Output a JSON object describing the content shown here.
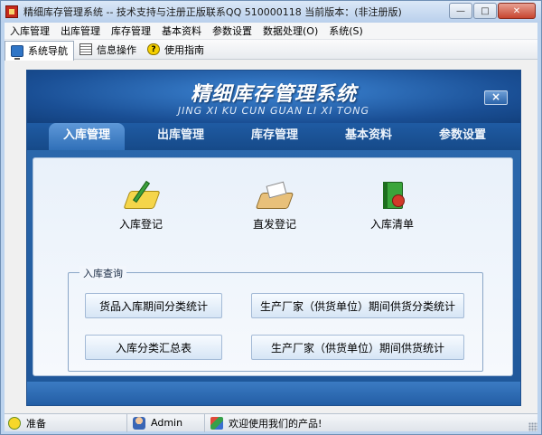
{
  "window": {
    "title": "精细库存管理系统 -- 技术支持与注册正版联系QQ 510000118    当前版本：(非注册版)",
    "minimize_glyph": "—",
    "maximize_glyph": "□",
    "close_glyph": "✕"
  },
  "menubar": {
    "items": [
      "入库管理",
      "出库管理",
      "库存管理",
      "基本资料",
      "参数设置",
      "数据处理(O)",
      "系统(S)"
    ]
  },
  "toolbar": {
    "items": [
      {
        "label": "系统导航",
        "icon": "monitor-icon"
      },
      {
        "label": "信息操作",
        "icon": "document-icon"
      },
      {
        "label": "使用指南",
        "icon": "help-icon"
      }
    ],
    "help_glyph": "?"
  },
  "banner": {
    "title": "精细库存管理系统",
    "subtitle": "JING XI KU CUN GUAN  LI XI TONG",
    "close_glyph": "×"
  },
  "tabs": [
    "入库管理",
    "出库管理",
    "库存管理",
    "基本资料",
    "参数设置"
  ],
  "features": [
    {
      "label": "入库登记",
      "icon": "register-pad-icon"
    },
    {
      "label": "直发登记",
      "icon": "direct-ship-icon"
    },
    {
      "label": "入库清单",
      "icon": "list-book-icon"
    }
  ],
  "query_group": {
    "legend": "入库查询",
    "buttons": [
      "货品入库期间分类统计",
      "生产厂家（供货单位）期间供货分类统计",
      "入库分类汇总表",
      "生产厂家（供货单位）期间供货统计"
    ]
  },
  "statusbar": {
    "ready": "准备",
    "user": "Admin",
    "message": "欢迎使用我们的产品!"
  },
  "colors": {
    "banner_blue": "#1a4f95",
    "tab_active": "#3070b8",
    "content_bg": "#e9f1fa"
  }
}
